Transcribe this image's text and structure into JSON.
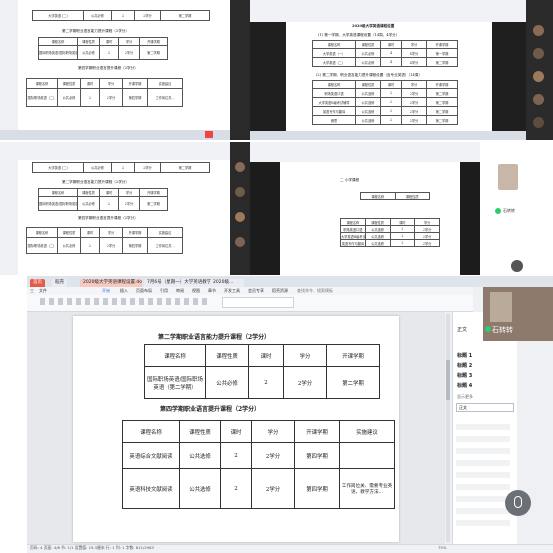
{
  "top_left": {
    "caption_3": "第二学期职业语言能力提升课程（2学分）",
    "caption_4": "第四学期职业语言提升课程（2学分）",
    "row_top": [
      "大学英语 (二)",
      "公共必修",
      "2",
      "2学分",
      "第二学期"
    ],
    "headers": [
      "课程名称",
      "课程性质",
      "课时",
      "学分",
      "开课学期",
      "实施建议"
    ],
    "row_mid": [
      "国际职场英语/国际职场英语（第二学期）",
      "公共必修",
      "2",
      "2学分",
      "第二学期"
    ],
    "row_bottom": [
      "国际职场英语（二）",
      "公共必修",
      "2",
      "2学分",
      "第四学期",
      "工作岗位关..."
    ]
  },
  "top_right": {
    "title": "2020级大学英语课程设置",
    "caption_1": "(1) 第一学期、大学英语课程设置（14周，4学分）",
    "caption_2": "(2) 第二学期、职业语言能力提升课程设置（含专业英语）（14周）",
    "headers": [
      "课程名称",
      "课程性质",
      "课时",
      "学分",
      "开课学期"
    ],
    "rows_a": [
      [
        "大学英语（一）",
        "公共必修",
        "4",
        "4学分",
        "第一学期"
      ],
      [
        "大学英语（二）",
        "公共必修",
        "4",
        "4学分",
        "第二学期"
      ]
    ],
    "rows_b": [
      [
        "职场英语口语",
        "公共选修",
        "2",
        "2学分",
        "第二学期"
      ],
      [
        "大学英语B级考试辅导",
        "公共选修",
        "2",
        "2学分",
        "第二学期"
      ],
      [
        "英语写作与翻译",
        "公共选修",
        "2",
        "2学分",
        "第二学期"
      ],
      [
        "雅思",
        "公共选修",
        "2",
        "2学分",
        "第二学期"
      ]
    ]
  },
  "bottom_right_mini": {
    "caption": "二 小学课程",
    "participant": "石转转"
  },
  "main_window": {
    "tabs": [
      "首页",
      "稻壳",
      "2020级大学英语课程设置.docx",
      "7月6号（星期一）大学英语教学",
      "2020级..."
    ],
    "menu": [
      "三",
      "文件",
      "开始",
      "插入",
      "页面布局",
      "引用",
      "审阅",
      "视图",
      "章节",
      "开发工具",
      "会员专享",
      "稻壳资源",
      "查找命令、搜索模板"
    ],
    "caption_top": "第二学期职业语言能力提升课程（2学分）",
    "caption_bottom": "第四学期职业语言提升课程（2学分）",
    "table_top": {
      "headers": [
        "课程名称",
        "课程性质",
        "课时",
        "学分",
        "开课学期"
      ],
      "row": [
        "国际职场英语/国际职场英语（第二学期）",
        "公共必修",
        "2",
        "2学分",
        "第二学期"
      ]
    },
    "table_bottom": {
      "headers": [
        "课程名称",
        "课程性质",
        "课时",
        "学分",
        "开课学期",
        "实施建议"
      ],
      "rows": [
        [
          "英语综合文献阅读",
          "公共选修",
          "2",
          "2学分",
          "第四学期",
          ""
        ],
        [
          "英语科技文献阅读",
          "公共选修",
          "2",
          "2学分",
          "第四学期",
          "工作岗位关、需要专业英语，教学方法..."
        ]
      ]
    },
    "nav_title": "正文",
    "nav_items": [
      "标题 1",
      "标题 2",
      "标题 3",
      "标题 4"
    ],
    "nav_label": "显示更多",
    "nav_select": "正文",
    "status_left": "页码: 4  页面: 4/6  节: 1/1  设置值: 19.3厘米  行: 1  列: 1  字数: 811/2983",
    "status_right": "75%",
    "participant": "石转转"
  },
  "colors": {
    "accent": "#3a7bd5",
    "tab_active": "#f7c9c0",
    "title_bar": "#e8eaf0",
    "mic_green": "#2ecc71"
  }
}
